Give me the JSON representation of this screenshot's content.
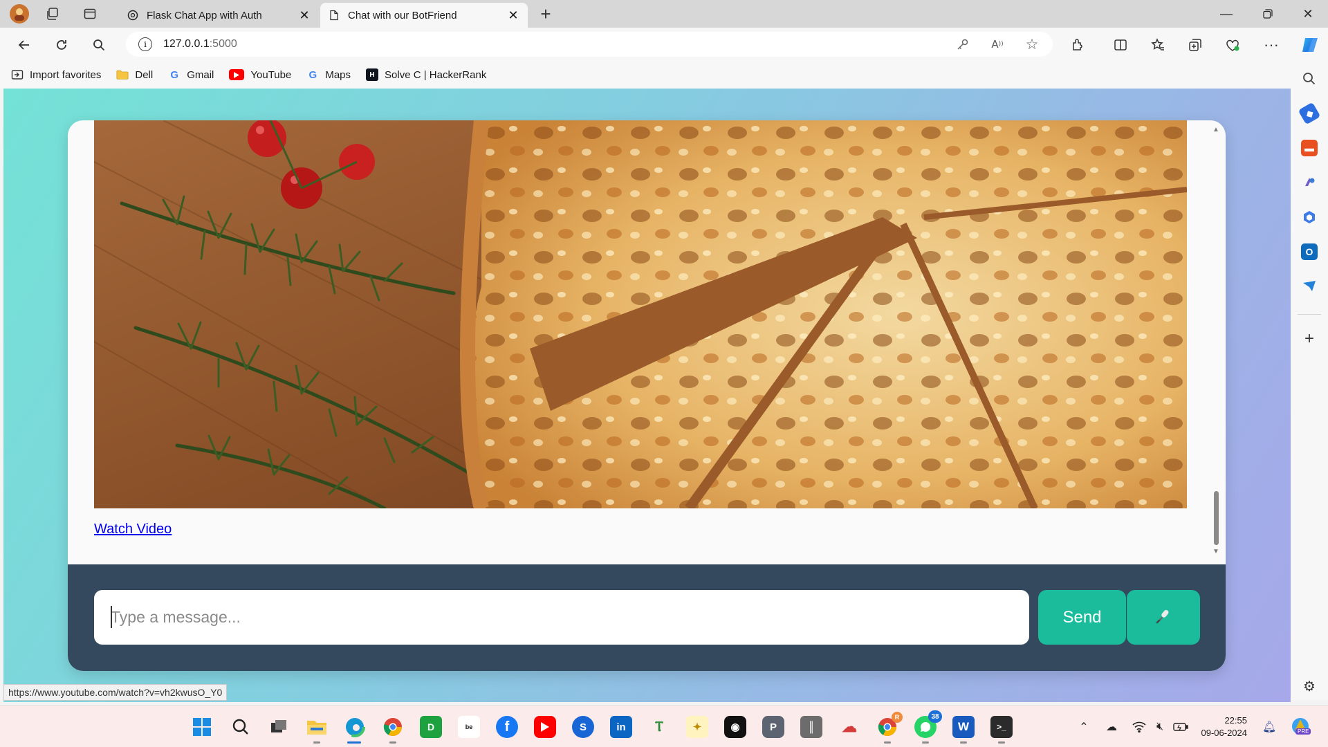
{
  "browser": {
    "tabs": [
      {
        "label": "Flask Chat App with Auth",
        "active": false
      },
      {
        "label": "Chat with our BotFriend",
        "active": true
      }
    ],
    "address": {
      "host": "127.0.0.1",
      "port": ":5000"
    },
    "favorites": [
      {
        "label": "Import favorites",
        "icon": "import-icon"
      },
      {
        "label": "Dell",
        "icon": "folder-icon"
      },
      {
        "label": "Gmail",
        "icon": "google-icon"
      },
      {
        "label": "YouTube",
        "icon": "youtube-icon"
      },
      {
        "label": "Maps",
        "icon": "google-icon"
      },
      {
        "label": "Solve C | HackerRank",
        "icon": "hackerrank-icon"
      }
    ],
    "status_url": "https://www.youtube.com/watch?v=vh2kwusO_Y0"
  },
  "chat": {
    "image_subject": "pizza",
    "watch_link": "Watch Video",
    "input_placeholder": "Type a message...",
    "send_label": "Send",
    "mic_icon": "microphone-icon"
  },
  "taskbar": {
    "time": "22:55",
    "date": "09-06-2024",
    "whatsapp_badge": "38",
    "chrome_badge": "R",
    "copilot_badge": "PRE"
  },
  "colors": {
    "accent": "#1abc9c",
    "input_bar": "#34495e",
    "gradient_start": "#74e2d6",
    "gradient_end": "#a6a8e9"
  }
}
